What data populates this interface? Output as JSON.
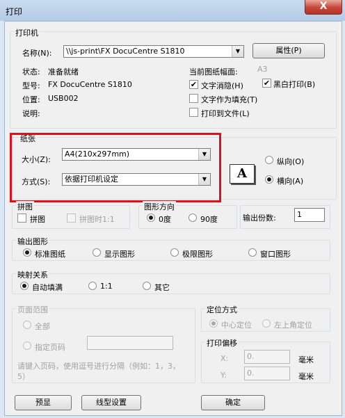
{
  "window": {
    "title": "打印",
    "close_glyph": "X"
  },
  "printer": {
    "legend": "打印机",
    "name_label": "名称(N):",
    "name_value": "\\\\js-print\\FX DocuCentre S1810",
    "properties_btn": "属性(P)",
    "status_label": "状态:",
    "status_value": "准备就绪",
    "type_label": "型号:",
    "type_value": "FX DocuCentre S1810",
    "location_label": "位置:",
    "location_value": "USB002",
    "comment_label": "说明:",
    "current_paper_label": "当前图纸幅面:",
    "current_paper_value": "A3",
    "text_antialias": "文字消隐(H)",
    "bw_print": "黑白打印(B)",
    "text_as_fill": "文字作为填充(T)",
    "print_to_file": "打印到文件(L)"
  },
  "paper": {
    "legend": "纸张",
    "size_label": "大小(Z):",
    "size_value": "A4(210x297mm)",
    "method_label": "方式(S):",
    "method_value": "依据打印机设定",
    "orientation_icon": "A",
    "portrait": "纵向(O)",
    "landscape": "横向(A)"
  },
  "tile": {
    "legend": "拼图",
    "tile": "拼图",
    "tile_when": "拼图时1:1"
  },
  "rotation": {
    "legend": "图形方向",
    "deg0": "0度",
    "deg90": "90度"
  },
  "copies": {
    "label": "输出份数:",
    "value": "1"
  },
  "output": {
    "legend": "输出图形",
    "standard": "标准图纸",
    "display": "显示图形",
    "limits": "极限图形",
    "window": "窗口图形"
  },
  "mapping": {
    "legend": "映射关系",
    "auto": "自动填满",
    "one_to_one": "1:1",
    "other": "其它"
  },
  "page_range": {
    "legend": "页面范围",
    "all": "全部",
    "specified": "指定页码",
    "hint": "请键入页码，使用逗号进行分隔（例如：1，3，5）"
  },
  "position": {
    "legend": "定位方式",
    "center": "中心定位",
    "top_left": "左上角定位"
  },
  "offset": {
    "legend": "打印偏移",
    "x_label": "X:",
    "x_value": "0.",
    "y_label": "Y:",
    "y_value": "0.",
    "unit": "毫米"
  },
  "buttons": {
    "preview": "预显",
    "line_settings": "线型设置",
    "ok": "确定"
  }
}
